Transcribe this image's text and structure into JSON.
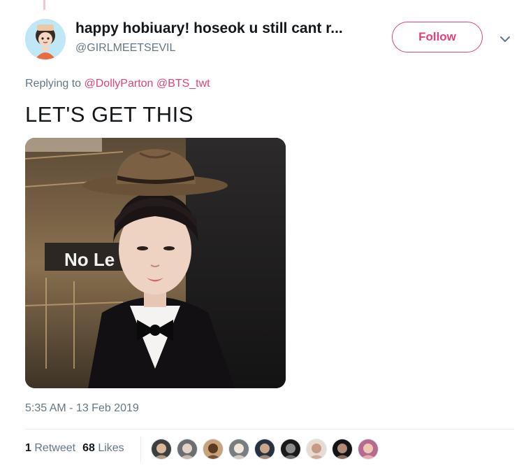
{
  "tweet": {
    "display_name": "happy hobiuary! hoseok u still cant r...",
    "handle": "@GIRLMEETSEVIL",
    "follow_label": "Follow",
    "replying_prefix": "Replying to ",
    "reply_mentions": [
      "@DollyParton",
      "@BTS_twt"
    ],
    "text": "LET'S GET THIS",
    "media_sign_text": "No Le",
    "timestamp": "5:35 AM - 13 Feb 2019",
    "retweet_count": "1",
    "retweet_label": "Retweet",
    "like_count": "68",
    "like_label": "Likes"
  },
  "colors": {
    "accent": "#e2407f",
    "muted_text": "#657786",
    "primary_text": "#14171a",
    "divider": "#e6ecf0"
  },
  "icons": {
    "more_menu": "chevron-down-icon"
  },
  "likers": [
    {
      "bg": "#3b3f3d",
      "fg": "#d9b89a"
    },
    {
      "bg": "#6b6e70",
      "fg": "#e3d3c4"
    },
    {
      "bg": "#c8a27a",
      "fg": "#5a3a22"
    },
    {
      "bg": "#7a7d80",
      "fg": "#f0e6da"
    },
    {
      "bg": "#273142",
      "fg": "#caa68a"
    },
    {
      "bg": "#1a1a1a",
      "fg": "#8c8c8c"
    },
    {
      "bg": "#e8dcd2",
      "fg": "#c79a85"
    },
    {
      "bg": "#141414",
      "fg": "#b08a74"
    },
    {
      "bg": "#b46b8f",
      "fg": "#f2c6b4"
    }
  ]
}
